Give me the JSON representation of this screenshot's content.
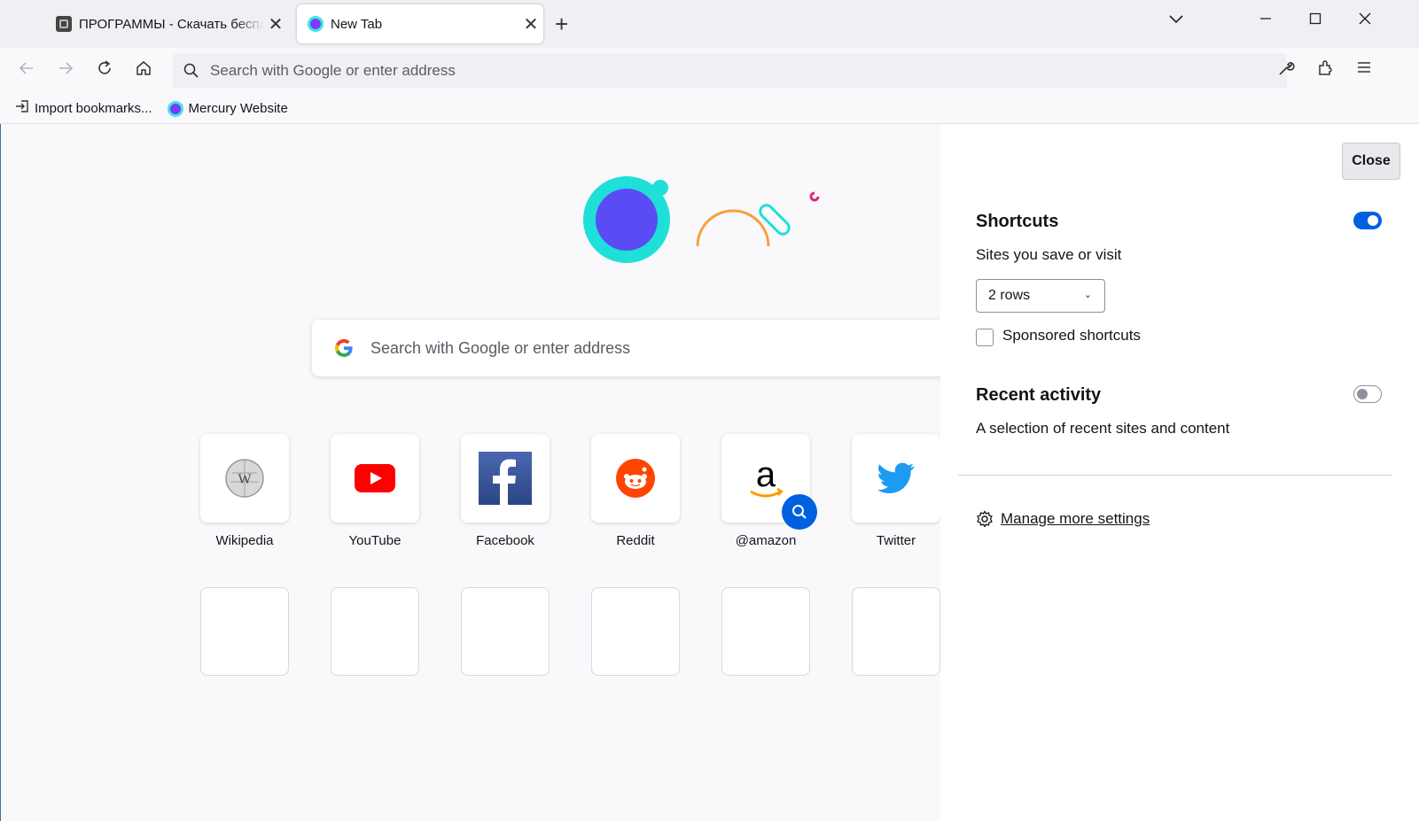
{
  "tabs": [
    {
      "title": "ПРОГРАММЫ - Скачать бесплатные программы",
      "active": false
    },
    {
      "title": "New Tab",
      "active": true
    }
  ],
  "navbar": {
    "url_placeholder": "Search with Google or enter address"
  },
  "bookmarks": [
    {
      "label": "Import bookmarks...",
      "icon": "import-icon"
    },
    {
      "label": "Mercury Website",
      "icon": "mercury-icon"
    }
  ],
  "content": {
    "search_placeholder": "Search with Google or enter address",
    "shortcuts": [
      {
        "label": "Wikipedia",
        "icon": "wikipedia-icon"
      },
      {
        "label": "YouTube",
        "icon": "youtube-icon"
      },
      {
        "label": "Facebook",
        "icon": "facebook-icon"
      },
      {
        "label": "Reddit",
        "icon": "reddit-icon"
      },
      {
        "label": "@amazon",
        "icon": "amazon-icon"
      },
      {
        "label": "Twitter",
        "icon": "twitter-icon"
      }
    ]
  },
  "panel": {
    "close_label": "Close",
    "shortcuts_title": "Shortcuts",
    "shortcuts_enabled": true,
    "shortcuts_desc": "Sites you save or visit",
    "rows_value": "2 rows",
    "sponsored_label": "Sponsored shortcuts",
    "sponsored_checked": false,
    "recent_title": "Recent activity",
    "recent_enabled": false,
    "recent_desc": "A selection of recent sites and content",
    "manage_label": "Manage more settings"
  },
  "colors": {
    "accent": "#0061e0",
    "mercury_teal": "#1ee0d8",
    "mercury_purple": "#5b4bf5"
  }
}
